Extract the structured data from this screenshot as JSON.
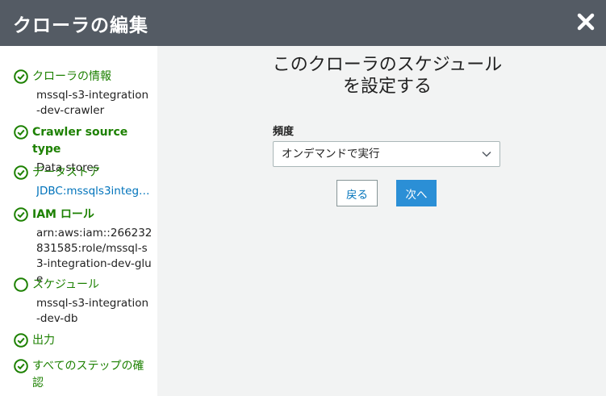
{
  "header": {
    "title": "クローラの編集",
    "close_icon": "close-icon"
  },
  "sidebar": {
    "steps": [
      {
        "label": "クローラの情報",
        "detail": "mssql-s3-integration-dev-crawler",
        "status": "complete"
      },
      {
        "label": "Crawler source type",
        "detail": "Data stores",
        "status": "complete"
      },
      {
        "label": "データストア",
        "detail": "JDBC:mssqls3integ…",
        "status": "complete"
      },
      {
        "label": "IAM ロール",
        "detail": "arn:aws:iam::266232831585:role/mssql-s3-integration-dev-glue",
        "status": "complete"
      },
      {
        "label": "スケジュール",
        "detail": "mssql-s3-integration-dev-db",
        "status": "current"
      },
      {
        "label": "出力",
        "detail": "",
        "status": "complete"
      },
      {
        "label": "すべてのステップの確認",
        "detail": "",
        "status": "complete"
      }
    ],
    "colors": {
      "complete": "#1d8102",
      "link": "#0073bb"
    }
  },
  "main": {
    "heading": "このクローラのスケジュールを設定する",
    "frequency": {
      "label": "頻度",
      "value": "オンデマンドで実行"
    },
    "buttons": {
      "back": "戻る",
      "next": "次へ"
    }
  }
}
